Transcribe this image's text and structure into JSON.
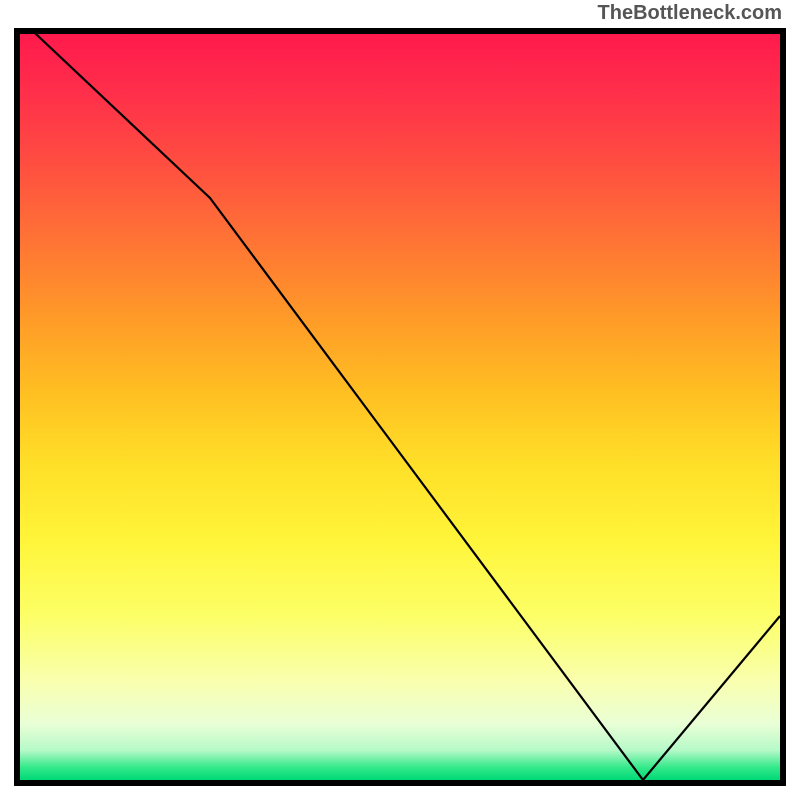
{
  "attribution": "TheBottleneck.com",
  "red_label": "",
  "colors": {
    "top": "#ff1a4d",
    "mid_orange": "#ff9a28",
    "mid_yellow": "#fff53a",
    "pale": "#f9ffb0",
    "green": "#00d977",
    "curve": "#000000",
    "border": "#000000",
    "red_ink": "#d92e1a"
  },
  "chart_data": {
    "type": "line",
    "title": "",
    "xlabel": "",
    "ylabel": "",
    "xlim": [
      0,
      100
    ],
    "ylim": [
      0,
      100
    ],
    "grid": false,
    "legend": false,
    "x": [
      0,
      25,
      82,
      100
    ],
    "values": [
      102,
      78,
      0,
      22
    ],
    "series_name": "curve",
    "notes": "Unlabeled axes; line descends from top-left, slight slope break around x≈25, reaches y=0 near x≈82, then rises to y≈22 at x=100. Background vertical performance gradient red→yellow→green; thin green band at bottom."
  }
}
